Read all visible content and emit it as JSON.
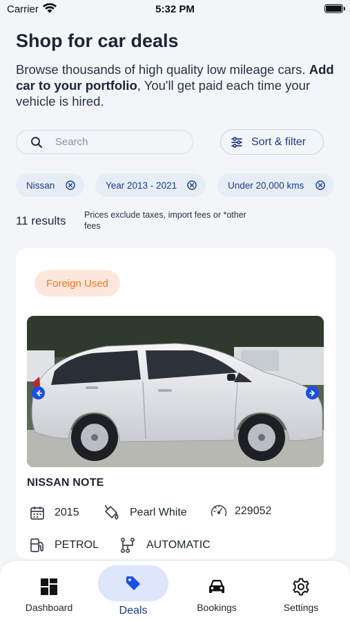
{
  "status_bar": {
    "carrier": "Carrier",
    "time": "5:32 PM"
  },
  "header": {
    "title": "Shop for car deals",
    "subtitle_lead": "Browse thousands of high quality low mileage cars.",
    "subtitle_bold": "Add car to your portfolio",
    "subtitle_tail": ", You'll get paid each time your vehicle is hired."
  },
  "search": {
    "placeholder": "Search",
    "value": ""
  },
  "sort_filter": {
    "label": "Sort & filter"
  },
  "filters": [
    {
      "label": "Nissan"
    },
    {
      "label": "Year 2013 - 2021"
    },
    {
      "label": "Under 20,000 kms"
    }
  ],
  "results": {
    "count_text": "11 results",
    "note": "Prices exclude taxes, import fees or *other fees"
  },
  "listing": {
    "badge": "Foreign Used",
    "name": "NISSAN NOTE",
    "year": "2015",
    "color": "Pearl White",
    "mileage": "229052",
    "fuel": "PETROL",
    "transmission": "AUTOMATIC"
  },
  "tabbar": {
    "active": "Deals",
    "items": [
      {
        "label": "Dashboard",
        "icon": "dashboard-icon"
      },
      {
        "label": "Deals",
        "icon": "tag-icon"
      },
      {
        "label": "Bookings",
        "icon": "car-icon"
      },
      {
        "label": "Settings",
        "icon": "gear-icon"
      }
    ]
  },
  "colors": {
    "accent_blue": "#1a4fe0",
    "label_blue": "#1d3a8a",
    "badge_orange": "#ee7a2b",
    "badge_bg": "#fde7dc",
    "background": "#f3f6f9"
  }
}
